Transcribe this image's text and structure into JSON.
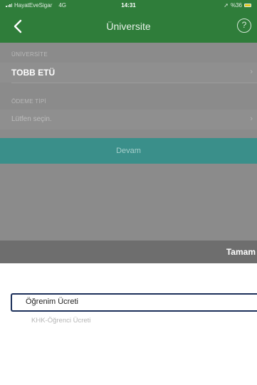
{
  "status_bar": {
    "carrier": "HayatEveSigar",
    "network": "4G",
    "time": "14:31",
    "battery_text": "%36"
  },
  "nav": {
    "title": "Üniversite",
    "back_icon": "chevron-left-icon",
    "help_icon": "question-circle-icon",
    "help_glyph": "?"
  },
  "form": {
    "university_label": "ÜNİVERSİTE",
    "university_value": "TOBB ETÜ",
    "payment_type_label": "ÖDEME TİPİ",
    "payment_type_placeholder": "Lütfen seçin.",
    "chevron": "›",
    "continue_label": "Devam"
  },
  "picker": {
    "done_label": "Tamam",
    "options": [
      "Öğrenim Ücreti",
      "KHK-Öğrenci Ücreti"
    ],
    "selected_index": 0
  },
  "colors": {
    "nav_green": "#2f7d3a",
    "continue_teal": "#3a8f8a",
    "selection_border": "#1c2f5a"
  }
}
